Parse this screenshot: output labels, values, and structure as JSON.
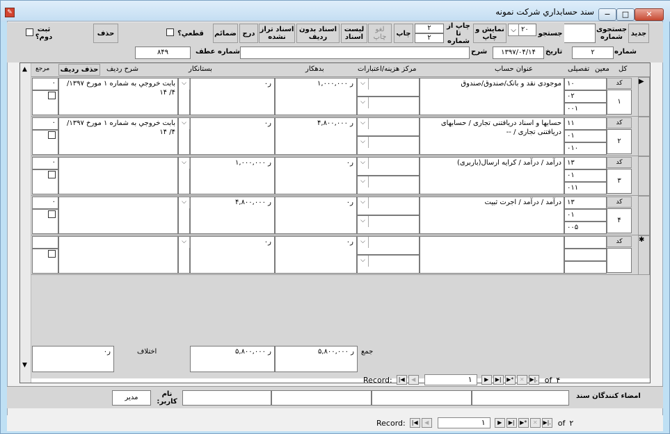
{
  "window": {
    "title": "سند حسابداري شركت نمونه",
    "min": "−",
    "max": "□",
    "close": "✕"
  },
  "toolbar": {
    "new": "جديد",
    "search_number": "جستجوی شماره",
    "search": "جستجو",
    "search_value": "۲۰",
    "show_print": "نمایش و چاپ",
    "print_from_label": "چاپ از تا شماره",
    "print_from": "۲",
    "print_to": "۲",
    "print": "چاپ",
    "cancel_print": "لغو چاپ",
    "doc_list": "لیست اسناد",
    "docs_no_row": "اسناد بدون ردیف",
    "docs_unbalanced": "اسناد تراز نشده",
    "insert": "درج",
    "attachments": "ضمائم",
    "final": "قطعي؟",
    "delete": "حذف",
    "register_twice": "ثبت دوم؟"
  },
  "header": {
    "number_label": "شماره",
    "number": "۲",
    "date_label": "تاريخ",
    "date": "۱۳۹۷/۰۴/۱۴",
    "desc_label": "شرح",
    "desc": "",
    "atf_label": "شماره عطف",
    "atf": "۸۴۹"
  },
  "columns": {
    "kol": "کل",
    "moein": "معین",
    "tafsili": "تفصیلی",
    "account_title": "عنوان حساب",
    "cost_center": "مرکز هزینه/اعتبارات",
    "debit": "بدهکار",
    "credit": "بستانکار",
    "row_desc": "شرح ردیف",
    "delete_row": "حذف ردیف",
    "ref": "مرجع"
  },
  "rows": [
    {
      "code": "کد",
      "num": "۱",
      "kol": "۱۰",
      "moein": "۰۲",
      "tafsili": "۰۰۱",
      "title": "موجودی نقد و بانک/صندوق/صندوق",
      "debit": "۱,۰۰۰,۰۰۰ ر",
      "credit": "ر۰",
      "desc": "بابت خروجي به شماره  ۱ مورخ ۱۳۹۷/ ۴/ ۱۴",
      "ref": "۰"
    },
    {
      "code": "کد",
      "num": "۲",
      "kol": "۱۱",
      "moein": "۰۱",
      "tafsili": "۰۱۰",
      "title": "حسابها و اسناد دریافتنی تجاری / حسابهای دریافتنی تجاری / --",
      "debit": "۴,۸۰۰,۰۰۰ ر",
      "credit": "ر۰",
      "desc": "بابت خروجي به شماره  ۱ مورخ ۱۳۹۷/ ۴/ ۱۴",
      "ref": "۰"
    },
    {
      "code": "کد",
      "num": "۳",
      "kol": "۱۳",
      "moein": "۰۱",
      "tafsili": "۰۱۱",
      "title": "درآمد / درآمد / کرایه ارسال(باربری)",
      "debit": "ر۰",
      "credit": "۱,۰۰۰,۰۰۰ ر",
      "desc": "",
      "ref": "۰"
    },
    {
      "code": "کد",
      "num": "۴",
      "kol": "۱۳",
      "moein": "۰۱",
      "tafsili": "۰۰۵",
      "title": "درآمد / درآمد / اجرت ثبیت",
      "debit": "ر۰",
      "credit": "۴,۸۰۰,۰۰۰ ر",
      "desc": "",
      "ref": "۰"
    },
    {
      "code": "کد",
      "num": "",
      "kol": "",
      "moein": "",
      "tafsili": "",
      "title": "",
      "debit": "ر۰",
      "credit": "ر۰",
      "desc": "",
      "ref": ""
    }
  ],
  "totals": {
    "sum_label": "جمع",
    "debit_total": "۵,۸۰۰,۰۰۰ ر",
    "credit_total": "۵,۸۰۰,۰۰۰ ر",
    "diff_label": "اختلاف",
    "diff": "ر۰"
  },
  "subnav": {
    "record_label": "Record:",
    "current": "۱",
    "of": "of",
    "total": "۴"
  },
  "signatures": {
    "label": "امضاء کنندگان سند",
    "user_label": "نام کاربر:",
    "user": "مدیر"
  },
  "mainnav": {
    "record_label": "Record:",
    "current": "۱",
    "of": "of",
    "total": "۲"
  }
}
